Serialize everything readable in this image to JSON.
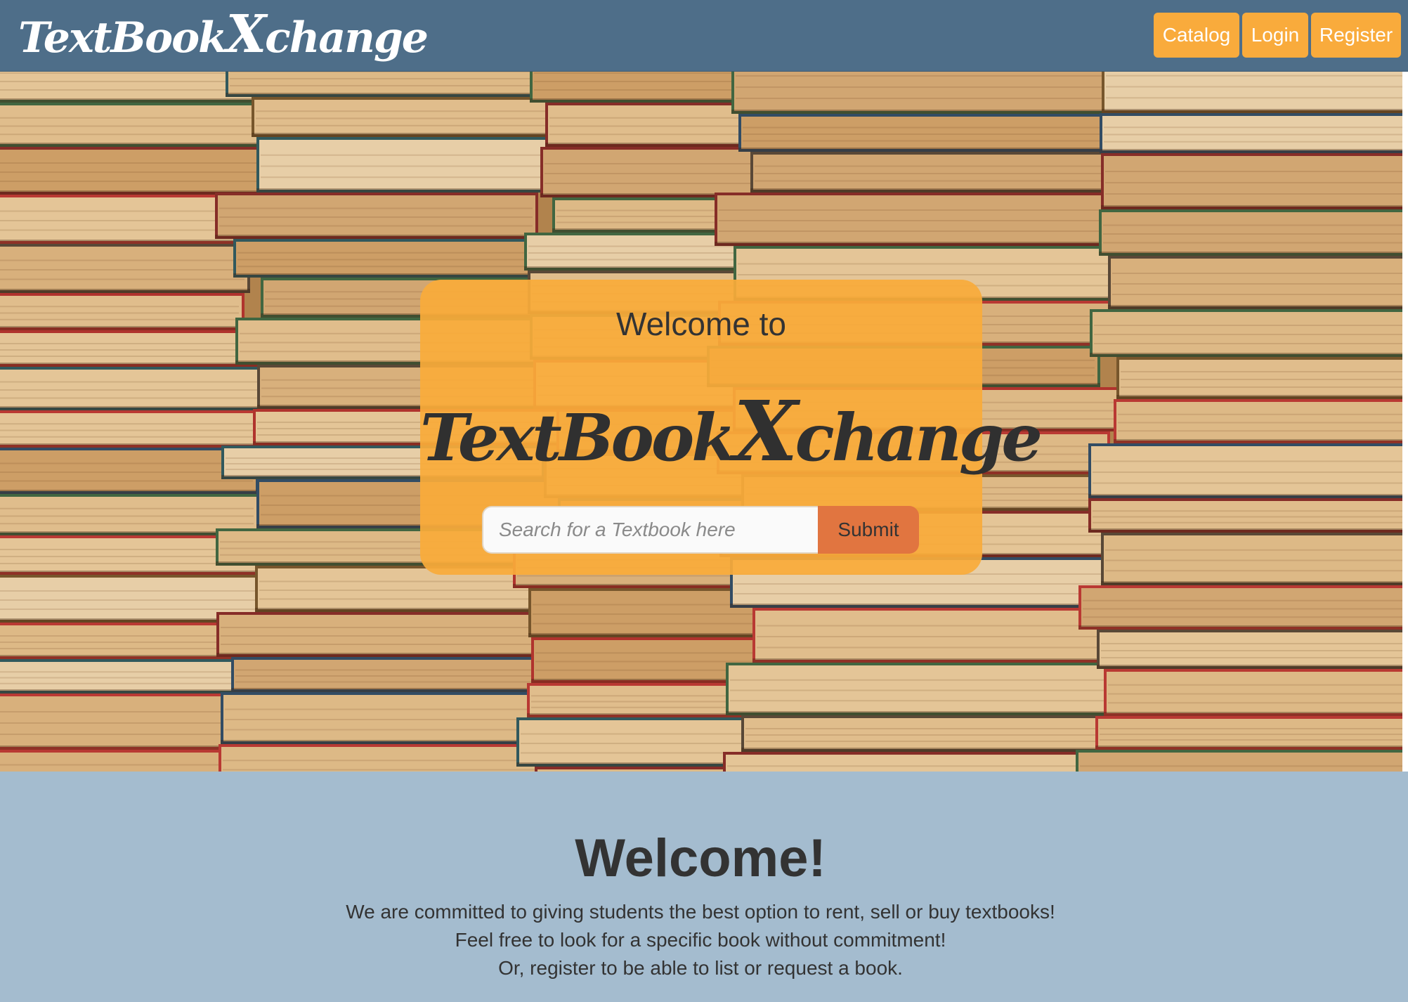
{
  "navbar": {
    "brand": "TextBook",
    "brand_x": "X",
    "brand_rest": "change",
    "buttons": {
      "catalog": "Catalog",
      "login": "Login",
      "register": "Register"
    }
  },
  "hero": {
    "welcome_to": "Welcome to",
    "logo": "TextBook",
    "logo_x": "X",
    "logo_rest": "change",
    "search": {
      "placeholder": "Search for a Textbook here",
      "value": ""
    },
    "submit_label": "Submit"
  },
  "info": {
    "title": "Welcome!",
    "lines": [
      "We are committed to giving students the best option to rent, sell or buy textbooks!",
      "Feel free to look for a specific book without commitment!",
      "Or, register to be able to list or request a book."
    ]
  },
  "colors": {
    "navbar": "#4e6e89",
    "accent": "#f9ab3c",
    "submit": "#e17540",
    "footer_bg": "#a4bccf",
    "text": "#333333"
  }
}
